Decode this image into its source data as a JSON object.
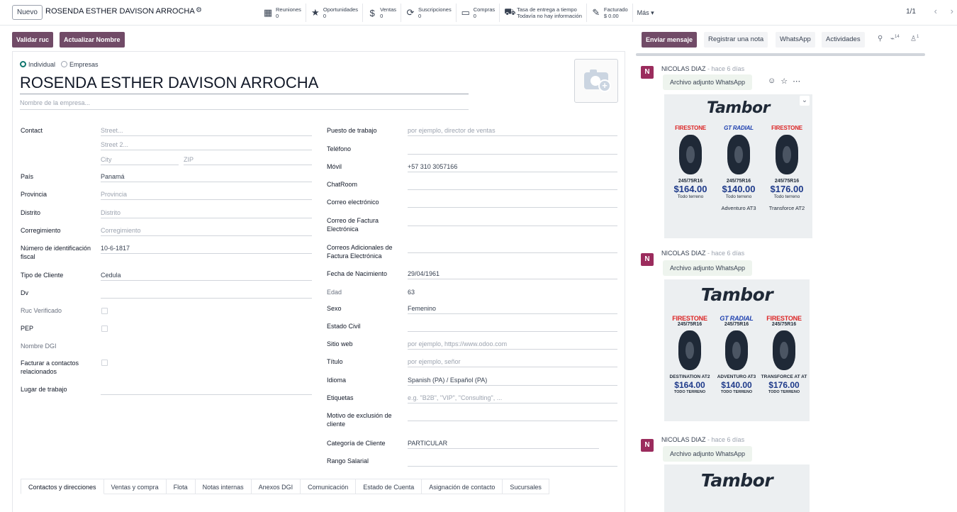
{
  "topbar": {
    "new_label": "Nuevo",
    "breadcrumb": "ROSENDA ESTHER DAVISON ARROCHA",
    "smart_buttons": [
      {
        "icon": "calendar-icon",
        "label": "Reuniones",
        "value": "0"
      },
      {
        "icon": "star-icon",
        "label": "Oportunidades",
        "value": "0"
      },
      {
        "icon": "dollar-icon",
        "label": "Ventas",
        "value": "0"
      },
      {
        "icon": "refresh-icon",
        "label": "Suscripciones",
        "value": "0"
      },
      {
        "icon": "credit-card-icon",
        "label": "Compras",
        "value": "0"
      },
      {
        "icon": "truck-icon",
        "label": "Tasa de entrega a tiempo",
        "value": "Todavía no hay información"
      },
      {
        "icon": "invoice-icon",
        "label": "Facturado",
        "value": "$ 0.00"
      }
    ],
    "more_label": "Más ▾",
    "pager": "1/1"
  },
  "actions": {
    "validate_ruc": "Validar ruc",
    "update_name": "Actualizar Nombre"
  },
  "chatter": {
    "send_message": "Enviar mensaje",
    "log_note": "Registrar una nota",
    "whatsapp": "WhatsApp",
    "activities": "Actividades",
    "attachments_count": "14",
    "followers_count": "1",
    "messages": [
      {
        "avatar": "N",
        "author": "NICOLAS DIAZ",
        "time": "- hace 6 días",
        "body": "Archivo adjunto WhatsApp"
      },
      {
        "avatar": "N",
        "author": "NICOLAS DIAZ",
        "time": "- hace 6 días",
        "body": "Archivo adjunto WhatsApp"
      },
      {
        "avatar": "N",
        "author": "NICOLAS DIAZ",
        "time": "- hace 6 días",
        "body": "Archivo adjunto WhatsApp"
      }
    ],
    "flyer1": {
      "brand": "Tambor",
      "items": [
        {
          "brand": "FIRESTONE",
          "size": "245/75R16",
          "price": "$164.00",
          "sub": "Todo terreno",
          "model": ""
        },
        {
          "brand": "GT RADIAL",
          "size": "245/75R16",
          "price": "$140.00",
          "sub": "Todo terreno",
          "model": "Adventuro AT3"
        },
        {
          "brand": "FIRESTONE",
          "size": "245/75R16",
          "price": "$176.00",
          "sub": "Todo terreno",
          "model": "Transforce AT2"
        }
      ]
    },
    "flyer2": {
      "brand": "Tambor",
      "items": [
        {
          "brand": "FIRESTONE",
          "size": "245/75R16",
          "model": "DESTINATION AT2",
          "price": "$164.00",
          "sub": "TODO TERRENO"
        },
        {
          "brand": "GT RADIAL",
          "size": "245/75R16",
          "model": "ADVENTURO AT3",
          "price": "$140.00",
          "sub": "TODO TERRENO"
        },
        {
          "brand": "FIRESTONE",
          "size": "245/75R16",
          "model": "TRANSFORCE AT AT",
          "price": "$176.00",
          "sub": "TODO TERRENO"
        }
      ]
    },
    "flyer3": {
      "brand": "Tambor"
    }
  },
  "form": {
    "type_individual": "Individual",
    "type_company": "Empresas",
    "name": "ROSENDA ESTHER DAVISON ARROCHA",
    "company_placeholder": "Nombre de la empresa...",
    "left": {
      "contact_label": "Contact",
      "street_ph": "Street...",
      "street2_ph": "Street 2...",
      "city_ph": "City",
      "zip_ph": "ZIP",
      "country_label": "País",
      "country_value": "Panamá",
      "province_label": "Provincia",
      "province_ph": "Provincia",
      "district_label": "Distrito",
      "district_ph": "Distrito",
      "corregimiento_label": "Corregimiento",
      "corregimiento_ph": "Corregimiento",
      "taxid_label": "Número de identificación fiscal",
      "taxid_value": "10-6-1817",
      "client_type_label": "Tipo de Cliente",
      "client_type_value": "Cedula",
      "dv_label": "Dv",
      "ruc_verified_label": "Ruc Verificado",
      "pep_label": "PEP",
      "dgi_name_label": "Nombre DGI",
      "invoice_related_label": "Facturar a contactos relacionados",
      "workplace_label": "Lugar de trabajo"
    },
    "right": {
      "job_label": "Puesto de trabajo",
      "job_ph": "por ejemplo, director de ventas",
      "phone_label": "Teléfono",
      "mobile_label": "Móvil",
      "mobile_value": "+57 310 3057166",
      "chatroom_label": "ChatRoom",
      "email_label": "Correo electrónico",
      "einvoice_email_label": "Correo de Factura Electrónica",
      "extra_emails_label": "Correos Adicionales de Factura Electrónica",
      "birth_label": "Fecha de Nacimiento",
      "birth_value": "29/04/1961",
      "age_label": "Edad",
      "age_value": "63",
      "sex_label": "Sexo",
      "sex_value": "Femenino",
      "civil_label": "Estado Civil",
      "website_label": "Sitio web",
      "website_ph": "por ejemplo, https://www.odoo.com",
      "title_label": "Título",
      "title_ph": "por ejemplo, señor",
      "lang_label": "Idioma",
      "lang_value": "Spanish (PA) / Español (PA)",
      "tags_label": "Etiquetas",
      "tags_ph": "e.g. \"B2B\", \"VIP\", \"Consulting\", ...",
      "exclusion_label": "Motivo de exclusión de cliente",
      "category_label": "Categoría de Cliente",
      "category_value": "PARTICULAR",
      "salary_label": "Rango Salarial"
    },
    "tabs": [
      "Contactos y direcciones",
      "Ventas y compra",
      "Flota",
      "Notas internas",
      "Anexos DGI",
      "Comunicación",
      "Estado de Cuenta",
      "Asignación de contacto",
      "Sucursales"
    ]
  },
  "colors": {
    "primary": "#714B67",
    "avatar": "#9b2c5d",
    "accent": "#0f766e"
  }
}
